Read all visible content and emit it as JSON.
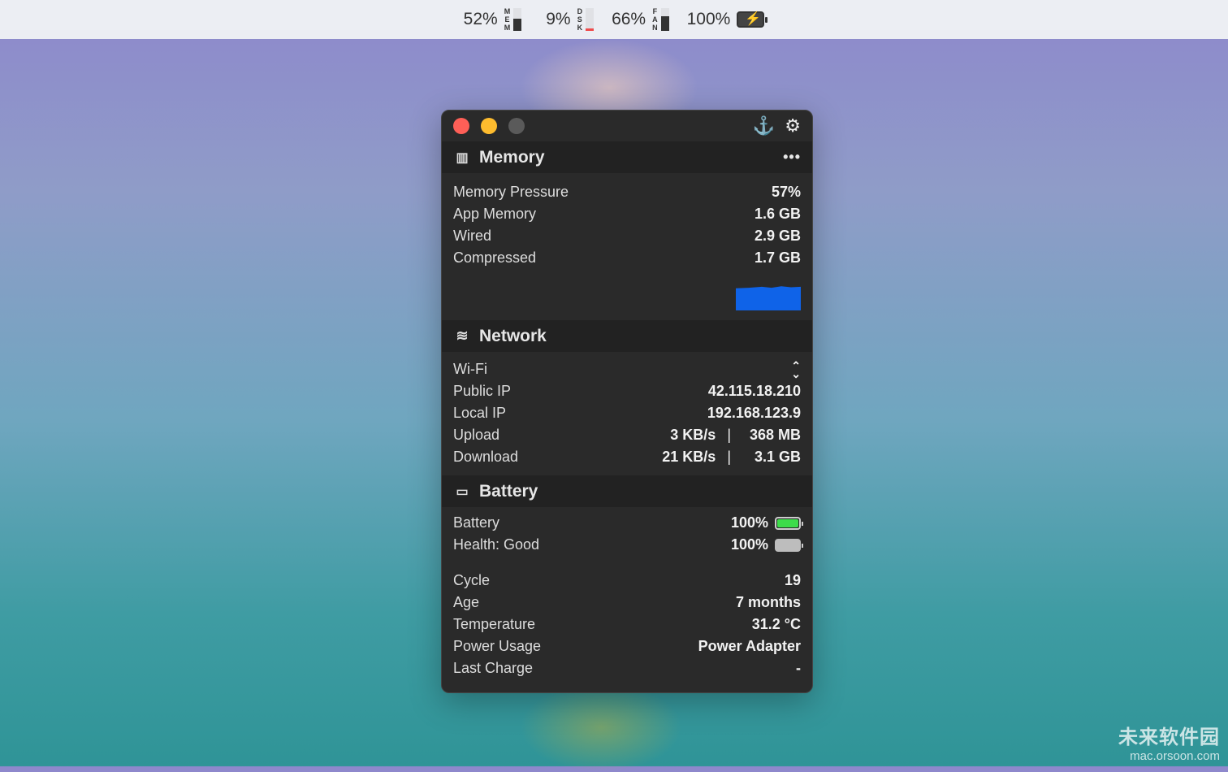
{
  "menubar": {
    "mem": {
      "value": "52%",
      "letters": [
        "M",
        "E",
        "M"
      ],
      "fill": 52
    },
    "dsk": {
      "value": "9%",
      "letters": [
        "D",
        "S",
        "K"
      ],
      "fill": 9,
      "color": "#ef4b4b"
    },
    "fan": {
      "value": "66%",
      "letters": [
        "F",
        "A",
        "N"
      ],
      "fill": 66
    },
    "battery": {
      "value": "100%"
    }
  },
  "window": {
    "memory": {
      "title": "Memory",
      "rows": [
        {
          "label": "Memory Pressure",
          "value": "57%"
        },
        {
          "label": "App Memory",
          "value": "1.6 GB"
        },
        {
          "label": "Wired",
          "value": "2.9 GB"
        },
        {
          "label": "Compressed",
          "value": "1.7 GB"
        }
      ],
      "graph_color": "#0f63e8"
    },
    "network": {
      "title": "Network",
      "interface": "Wi-Fi",
      "rows": [
        {
          "label": "Public IP",
          "value": "42.115.18.210"
        },
        {
          "label": "Local IP",
          "value": "192.168.123.9"
        }
      ],
      "upload": {
        "label": "Upload",
        "rate": "3 KB/s",
        "sep": "|",
        "total": "368 MB"
      },
      "download": {
        "label": "Download",
        "rate": "21 KB/s",
        "sep": "|",
        "total": "3.1 GB"
      }
    },
    "battery": {
      "title": "Battery",
      "battery": {
        "label": "Battery",
        "value": "100%",
        "level": 100,
        "color": "#3ddc4a"
      },
      "health": {
        "label": "Health: Good",
        "value": "100%",
        "level": 100,
        "color": "#bdbdbd"
      },
      "rows": [
        {
          "label": "Cycle",
          "value": "19"
        },
        {
          "label": "Age",
          "value": "7 months"
        },
        {
          "label": "Temperature",
          "value": "31.2 °C"
        },
        {
          "label": "Power Usage",
          "value": "Power Adapter"
        },
        {
          "label": "Last Charge",
          "value": "-"
        }
      ]
    }
  },
  "watermark": {
    "brand": "未来软件园",
    "url": "mac.orsoon.com"
  }
}
